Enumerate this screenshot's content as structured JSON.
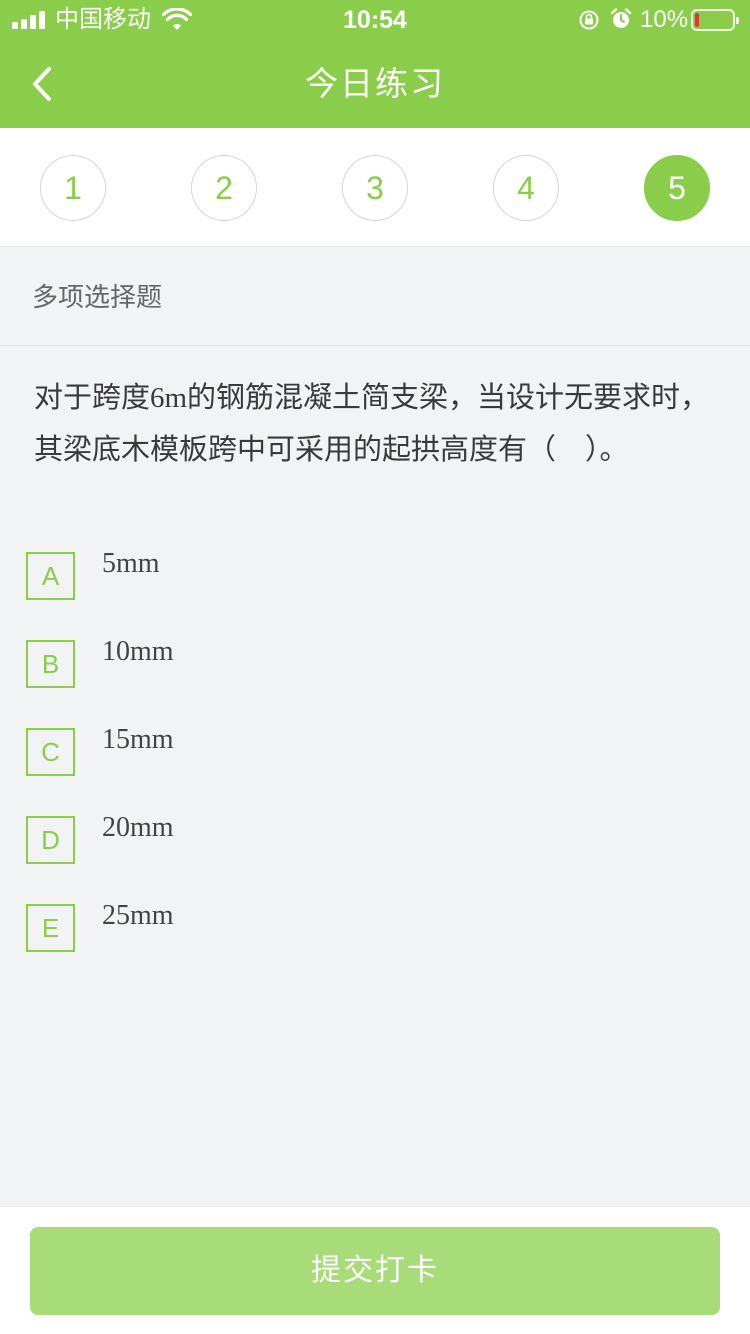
{
  "status_bar": {
    "carrier": "中国移动",
    "time": "10:54",
    "battery_percent": "10%",
    "battery_level": 0.1,
    "icons": [
      "signal-icon",
      "wifi-icon",
      "rotation-lock-icon",
      "alarm-icon",
      "battery-icon"
    ]
  },
  "nav": {
    "title": "今日练习",
    "back_icon": "chevron-left-icon"
  },
  "question_nav": {
    "items": [
      "1",
      "2",
      "3",
      "4",
      "5"
    ],
    "active_index": 4
  },
  "question": {
    "type": "多项选择题",
    "text": "对于跨度6m的钢筋混凝土简支梁，当设计无要求时，其梁底木模板跨中可采用的起拱高度有（　）。",
    "options": [
      {
        "letter": "A",
        "text": "5mm"
      },
      {
        "letter": "B",
        "text": "10mm"
      },
      {
        "letter": "C",
        "text": "15mm"
      },
      {
        "letter": "D",
        "text": "20mm"
      },
      {
        "letter": "E",
        "text": "25mm"
      }
    ]
  },
  "footer": {
    "submit_label": "提交打卡"
  },
  "colors": {
    "accent": "#8acd4a",
    "submit_bg": "#a7dc78",
    "page_bg": "#f2f3f5"
  }
}
